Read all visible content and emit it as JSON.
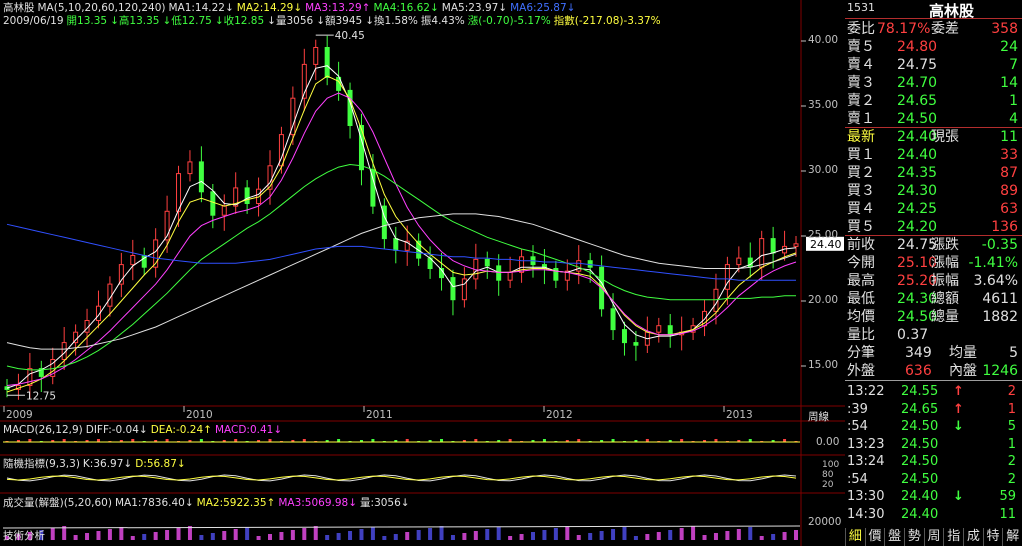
{
  "stock": {
    "code": "1531",
    "name": "高林股"
  },
  "header": {
    "line1": [
      {
        "t": "高林股",
        "c": "w"
      },
      {
        "t": "MA(5,10,20,60,120,240)",
        "c": "w"
      },
      {
        "t": "MA1:14.22↓",
        "c": "w"
      },
      {
        "t": "MA2:14.29↓",
        "c": "y"
      },
      {
        "t": "MA3:13.29↑",
        "c": "m"
      },
      {
        "t": "MA4:16.62↓",
        "c": "g"
      },
      {
        "t": "MA5:23.97↓",
        "c": "w"
      },
      {
        "t": "MA6:25.87↓",
        "c": "b"
      }
    ],
    "line2": [
      {
        "t": "2009/06/19",
        "c": "w"
      },
      {
        "t": "開13.35",
        "c": "g"
      },
      {
        "t": "↓高13.35",
        "c": "g"
      },
      {
        "t": "↓低12.75",
        "c": "g"
      },
      {
        "t": "↓收12.85",
        "c": "g"
      },
      {
        "t": "↓量3056",
        "c": "w"
      },
      {
        "t": "↓額3945",
        "c": "w"
      },
      {
        "t": "↓換1.58%",
        "c": "w"
      },
      {
        "t": "振4.43%",
        "c": "w"
      },
      {
        "t": "漲(-0.70)-5.17%",
        "c": "g"
      },
      {
        "t": "指數(-217.08)-3.37%",
        "c": "y"
      }
    ]
  },
  "chart_data": {
    "type": "candlestick",
    "x_labels": [
      "2009",
      "2010",
      "2011",
      "2012",
      "2013"
    ],
    "y_ticks": [
      "40.00",
      "35.00",
      "30.00",
      "25.00",
      "20.00",
      "15.00"
    ],
    "ylim": [
      12,
      41
    ],
    "max_label": "40.45",
    "min_label": "12.75",
    "current_label": "24.40",
    "period_label": "周線",
    "close": [
      13.2,
      13.5,
      14.8,
      14.2,
      15.5,
      16.8,
      17.6,
      18.5,
      19.6,
      21.3,
      22.8,
      23.5,
      22.6,
      24.7,
      26.9,
      29.8,
      30.7,
      28.4,
      26.6,
      27.3,
      28.7,
      27.5,
      28.6,
      30.4,
      32.8,
      35.6,
      38.2,
      39.5,
      37.2,
      36.2,
      33.5,
      30.1,
      27.3,
      24.8,
      23.9,
      24.6,
      23.3,
      22.5,
      21.8,
      20.1,
      21.7,
      23.2,
      22.7,
      21.6,
      22.2,
      23.4,
      22.8,
      22.5,
      21.6,
      22.3,
      23.1,
      22.6,
      19.4,
      17.8,
      16.8,
      16.6,
      17.6,
      18.1,
      17.4,
      17.6,
      18.1,
      19.2,
      20.9,
      22.8,
      23.3,
      22.6,
      24.8,
      23.7,
      24.2,
      24.4
    ],
    "ma_series": [
      {
        "name": "MA1",
        "color": "#ffffff",
        "values": [
          13.3,
          13.6,
          14.4,
          14.7,
          15.2,
          16.0,
          17.0,
          17.9,
          18.9,
          20.2,
          21.6,
          22.7,
          23.3,
          23.8,
          25.0,
          27.0,
          28.8,
          29.2,
          28.5,
          27.5,
          27.4,
          27.9,
          28.2,
          29.1,
          31.0,
          33.5,
          36.0,
          37.9,
          38.1,
          37.3,
          35.3,
          32.4,
          29.4,
          26.5,
          24.8,
          24.5,
          23.9,
          23.3,
          22.4,
          21.1,
          21.3,
          22.3,
          22.6,
          22.2,
          22.2,
          22.6,
          22.6,
          22.6,
          22.3,
          22.2,
          22.5,
          22.4,
          21.4,
          19.8,
          18.2,
          17.4,
          17.1,
          17.3,
          17.3,
          17.5,
          17.8,
          18.6,
          19.8,
          21.4,
          22.5,
          22.8,
          23.5,
          23.7,
          24.0,
          24.1
        ]
      },
      {
        "name": "MA2",
        "color": "#ffff40",
        "values": [
          13.0,
          13.3,
          13.6,
          14.0,
          14.6,
          15.4,
          16.3,
          17.2,
          18.1,
          19.0,
          20.0,
          21.0,
          22.0,
          22.9,
          24.3,
          26.1,
          27.6,
          27.9,
          27.6,
          27.3,
          27.5,
          27.8,
          28.0,
          28.8,
          30.3,
          32.5,
          34.7,
          36.7,
          37.3,
          36.9,
          35.5,
          33.2,
          30.6,
          28.2,
          26.5,
          25.4,
          24.4,
          23.6,
          22.9,
          22.2,
          22.0,
          22.1,
          22.3,
          22.2,
          22.2,
          22.4,
          22.5,
          22.5,
          22.3,
          22.2,
          22.1,
          21.9,
          21.1,
          20.0,
          18.9,
          18.1,
          17.6,
          17.4,
          17.4,
          17.6,
          17.8,
          18.3,
          19.1,
          20.2,
          21.2,
          21.9,
          22.6,
          23.0,
          23.4,
          23.7
        ]
      },
      {
        "name": "MA3",
        "color": "#ff40ff",
        "values": [
          13.5,
          13.6,
          13.8,
          14.0,
          14.4,
          14.9,
          15.5,
          16.2,
          16.9,
          17.7,
          18.6,
          19.5,
          20.4,
          21.3,
          22.4,
          23.7,
          25.0,
          25.8,
          26.2,
          26.5,
          26.8,
          27.0,
          27.3,
          28.0,
          29.3,
          31.0,
          32.9,
          34.6,
          35.6,
          36.0,
          35.6,
          34.6,
          33.0,
          31.0,
          29.0,
          27.2,
          25.8,
          24.7,
          23.8,
          23.1,
          22.7,
          22.4,
          22.3,
          22.2,
          22.2,
          22.3,
          22.4,
          22.4,
          22.3,
          22.2,
          22.0,
          21.7,
          21.0,
          20.0,
          19.0,
          18.2,
          17.7,
          17.4,
          17.4,
          17.5,
          17.7,
          18.1,
          18.7,
          19.5,
          20.4,
          21.1,
          21.8,
          22.3,
          22.7,
          23.0
        ]
      },
      {
        "name": "MA4",
        "color": "#40ff40",
        "values": [
          15.0,
          14.8,
          14.7,
          14.7,
          14.8,
          15.0,
          15.3,
          15.7,
          16.2,
          16.8,
          17.5,
          18.2,
          19.0,
          19.8,
          20.6,
          21.5,
          22.4,
          23.2,
          23.8,
          24.4,
          25.0,
          25.6,
          26.1,
          26.7,
          27.4,
          28.1,
          28.8,
          29.4,
          29.9,
          30.3,
          30.5,
          30.4,
          30.1,
          29.6,
          29.0,
          28.4,
          27.8,
          27.2,
          26.6,
          26.1,
          25.7,
          25.3,
          24.9,
          24.6,
          24.3,
          24.0,
          23.8,
          23.5,
          23.2,
          22.9,
          22.6,
          22.2,
          21.7,
          21.2,
          20.8,
          20.5,
          20.3,
          20.2,
          20.1,
          20.1,
          20.1,
          20.1,
          20.1,
          20.2,
          20.2,
          20.2,
          20.3,
          20.3,
          20.4,
          20.4
        ]
      },
      {
        "name": "MA5",
        "color": "#e0e0e0",
        "values": [
          16.8,
          16.6,
          16.4,
          16.3,
          16.3,
          16.3,
          16.4,
          16.5,
          16.7,
          16.9,
          17.1,
          17.4,
          17.7,
          18.0,
          18.4,
          18.8,
          19.2,
          19.6,
          20.0,
          20.4,
          20.8,
          21.2,
          21.6,
          22.0,
          22.4,
          22.8,
          23.2,
          23.6,
          24.0,
          24.4,
          24.8,
          25.2,
          25.5,
          25.8,
          26.0,
          26.2,
          26.4,
          26.5,
          26.6,
          26.7,
          26.7,
          26.7,
          26.6,
          26.5,
          26.3,
          26.1,
          25.9,
          25.6,
          25.3,
          25.0,
          24.7,
          24.4,
          24.1,
          23.8,
          23.5,
          23.3,
          23.1,
          22.9,
          22.8,
          22.7,
          22.6,
          22.5,
          22.5,
          22.5,
          22.5,
          22.6,
          22.8,
          23.0,
          23.3,
          23.6
        ]
      },
      {
        "name": "MA6",
        "color": "#3050ff",
        "values": [
          25.9,
          25.7,
          25.5,
          25.3,
          25.1,
          24.9,
          24.7,
          24.5,
          24.3,
          24.1,
          23.9,
          23.7,
          23.5,
          23.3,
          23.2,
          23.1,
          23.0,
          22.9,
          22.9,
          22.9,
          22.9,
          23.0,
          23.1,
          23.2,
          23.4,
          23.6,
          23.8,
          24.0,
          24.1,
          24.2,
          24.2,
          24.2,
          24.1,
          24.0,
          23.9,
          23.8,
          23.7,
          23.6,
          23.5,
          23.4,
          23.4,
          23.3,
          23.3,
          23.2,
          23.2,
          23.1,
          23.1,
          23.0,
          23.0,
          22.9,
          22.9,
          22.8,
          22.7,
          22.6,
          22.5,
          22.4,
          22.3,
          22.2,
          22.1,
          22.0,
          21.9,
          21.8,
          21.7,
          21.7,
          21.6,
          21.6,
          21.6,
          21.6,
          21.6,
          21.6
        ]
      }
    ],
    "macd": {
      "label_name": "MACD(26,12,9)",
      "diff": "DIFF:-0.04↓",
      "dea": "DEA:-0.24↑",
      "macd": "MACD:0.41↓",
      "tick": "0.00"
    },
    "kd": {
      "label_name": "隨機指標(9,3,3)",
      "k": "K:36.97↓",
      "d": "D:56.87↓",
      "ticks": [
        "100",
        "80",
        "20"
      ]
    },
    "volume": {
      "label_name": "成交量(解盤)(5,20,60)",
      "ma1": "MA1:7836.40↓",
      "ma2": "MA2:5922.35↑",
      "ma3": "MA3:5069.98↓",
      "vol": "量:3056↓",
      "tick": "20000"
    },
    "footer_label": "技術分析"
  },
  "quote": {
    "weibi_label": "委比",
    "weibi": "78.17%",
    "title": "高林股",
    "weicha_label": "委差",
    "weicha": "358",
    "asks": [
      {
        "label": "賣５",
        "price": "24.80",
        "vol": "24",
        "pc": "r"
      },
      {
        "label": "賣４",
        "price": "24.75",
        "vol": "7",
        "pc": "w"
      },
      {
        "label": "賣３",
        "price": "24.70",
        "vol": "14",
        "pc": "g"
      },
      {
        "label": "賣２",
        "price": "24.65",
        "vol": "1",
        "pc": "g"
      },
      {
        "label": "賣１",
        "price": "24.50",
        "vol": "4",
        "pc": "g"
      }
    ],
    "last_label": "最新",
    "last": "24.40",
    "now_label": "現張",
    "now": "11",
    "bids": [
      {
        "label": "買１",
        "price": "24.40",
        "vol": "33"
      },
      {
        "label": "買２",
        "price": "24.35",
        "vol": "87"
      },
      {
        "label": "買３",
        "price": "24.30",
        "vol": "89"
      },
      {
        "label": "買４",
        "price": "24.25",
        "vol": "63"
      },
      {
        "label": "買５",
        "price": "24.20",
        "vol": "136"
      }
    ],
    "stats": [
      {
        "k": "前收",
        "v": "24.75",
        "vc": "w",
        "k2": "漲跌",
        "v2": "-0.35",
        "v2c": "g"
      },
      {
        "k": "今開",
        "v": "25.10",
        "vc": "r",
        "k2": "漲幅",
        "v2": "-1.41%",
        "v2c": "g"
      },
      {
        "k": "最高",
        "v": "25.20",
        "vc": "r",
        "k2": "振幅",
        "v2": "3.64%",
        "v2c": "w"
      },
      {
        "k": "最低",
        "v": "24.30",
        "vc": "g",
        "k2": "總額",
        "v2": "4611",
        "v2c": "w"
      },
      {
        "k": "均價",
        "v": "24.50",
        "vc": "g",
        "k2": "總量",
        "v2": "1882",
        "v2c": "w"
      }
    ],
    "liangbi_label": "量比",
    "liangbi": "0.37",
    "fenbi_label": "分筆",
    "fenbi": "349",
    "junliang_label": "均量",
    "junliang": "5",
    "wai_label": "外盤",
    "wai": "636",
    "nei_label": "內盤",
    "nei": "1246",
    "ticks": [
      {
        "t": "13:22",
        "p": "24.55",
        "a": "↑",
        "ac": "r",
        "q": "2",
        "qc": "r"
      },
      {
        "t": ":39",
        "p": "24.65",
        "a": "↑",
        "ac": "r",
        "q": "1",
        "qc": "r"
      },
      {
        "t": ":54",
        "p": "24.50",
        "a": "↓",
        "ac": "g",
        "q": "5",
        "qc": "g"
      },
      {
        "t": "13:23",
        "p": "24.50",
        "a": "",
        "ac": "g",
        "q": "1",
        "qc": "g"
      },
      {
        "t": "13:24",
        "p": "24.50",
        "a": "",
        "ac": "g",
        "q": "2",
        "qc": "g"
      },
      {
        "t": ":54",
        "p": "24.50",
        "a": "",
        "ac": "g",
        "q": "2",
        "qc": "g"
      },
      {
        "t": "13:30",
        "p": "24.40",
        "a": "↓",
        "ac": "g",
        "q": "59",
        "qc": "g"
      },
      {
        "t": "14:30",
        "p": "24.40",
        "a": "",
        "ac": "g",
        "q": "11",
        "qc": "g"
      }
    ],
    "tabs": [
      "細",
      "價",
      "盤",
      "勢",
      "周",
      "指",
      "成",
      "特",
      "解"
    ]
  },
  "colors": {
    "up": "#ff4040",
    "down": "#40ff40",
    "grid": "#800000",
    "axis": "#c0c0c0"
  }
}
